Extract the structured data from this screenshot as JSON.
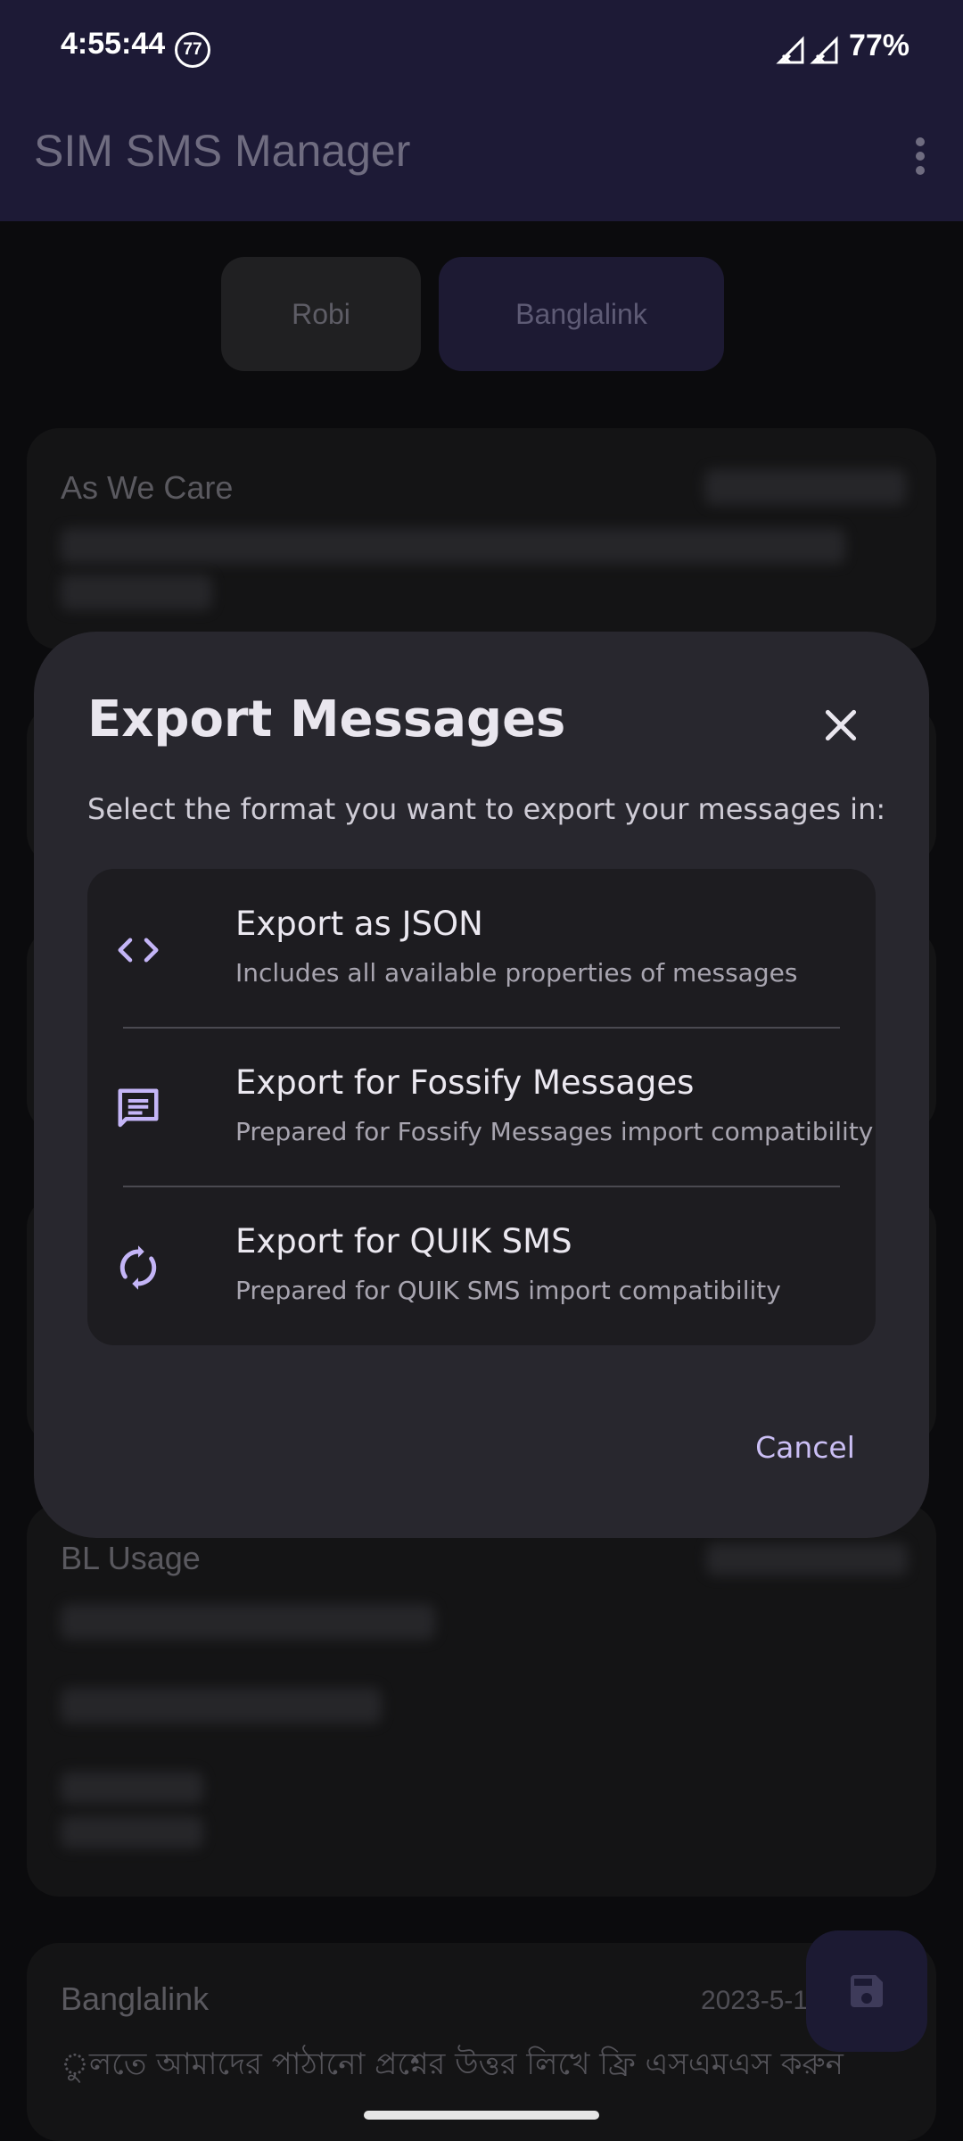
{
  "status_bar": {
    "time": "4:55:44",
    "notification_badge": "77",
    "battery": "77%"
  },
  "app_bar": {
    "title": "SIM SMS Manager",
    "menu_icon": "more-vert-icon"
  },
  "sim_tabs": [
    {
      "label": "Robi",
      "selected": false
    },
    {
      "label": "Banglalink",
      "selected": true
    }
  ],
  "messages": [
    {
      "sender": "As We Care"
    },
    {
      "sender": "BL Usage"
    },
    {
      "sender": "Banglalink",
      "date": "2023-5-1",
      "body": "ুলতে আমাদের পাঠানো প্রশ্নের উত্তর লিখে ফ্রি এসএমএস করুন"
    }
  ],
  "fab": {
    "icon": "save-icon"
  },
  "dialog": {
    "title": "Export Messages",
    "subtitle": "Select the format you want to export your messages in:",
    "options": [
      {
        "icon": "code-icon",
        "title": "Export as JSON",
        "description": "Includes all available properties of messages"
      },
      {
        "icon": "message-icon",
        "title": "Export for Fossify Messages",
        "description": "Prepared for Fossify Messages import compatibility"
      },
      {
        "icon": "sync-icon",
        "title": "Export for QUIK SMS",
        "description": "Prepared for QUIK SMS import compatibility"
      }
    ],
    "cancel_label": "Cancel"
  },
  "colors": {
    "accent": "#c4b5f7",
    "dialog_bg": "#28272e",
    "app_bar": "#1d1a36"
  }
}
